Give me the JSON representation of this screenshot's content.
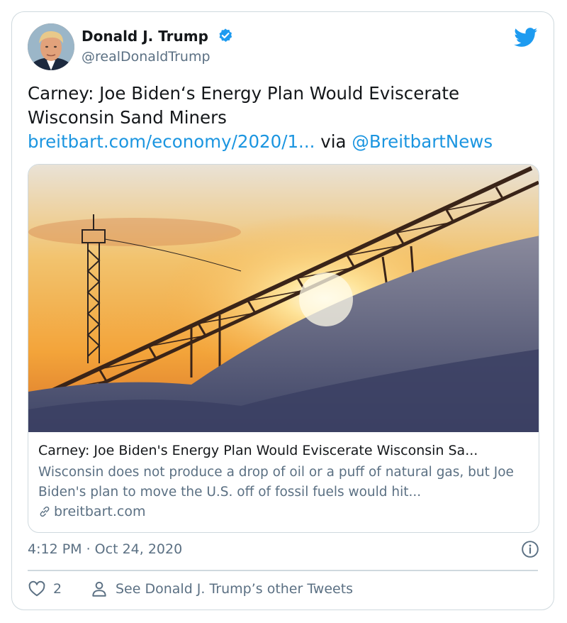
{
  "tweet": {
    "author_name": "Donald J. Trump",
    "handle": "@realDonaldTrump",
    "text_line1": "Carney: Joe Biden‘s Energy Plan Would Eviscerate",
    "text_line2": "Wisconsin Sand Miners",
    "url_text": "breitbart.com/economy/2020/1...",
    "via_text": " via ",
    "via_handle": "@BreitbartNews",
    "timestamp": "4:12 PM · Oct 24, 2020"
  },
  "link_card": {
    "title": "Carney: Joe Biden's Energy Plan Would Eviscerate Wisconsin Sa...",
    "description": "Wisconsin does not produce a drop of oil or a puff of natural gas, but Joe Biden's plan to move the U.S. off of fossil fuels would hit...",
    "domain": "breitbart.com"
  },
  "actions": {
    "like_count": "2",
    "see_more": "See Donald J. Trump’s other Tweets"
  },
  "colors": {
    "link": "#1b95e0",
    "muted": "#5b7083",
    "border": "#cfd9de"
  },
  "icons": [
    "verified-badge-icon",
    "twitter-bird-icon",
    "link-icon",
    "info-icon",
    "heart-icon",
    "person-icon"
  ]
}
